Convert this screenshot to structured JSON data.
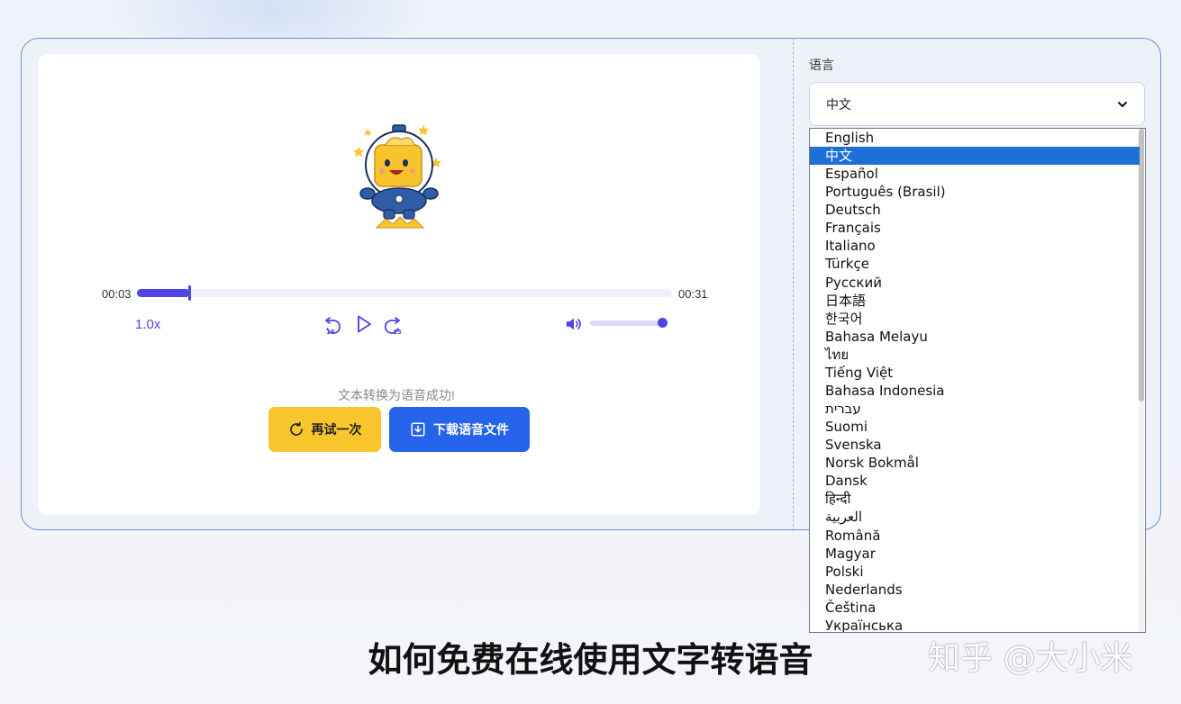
{
  "player": {
    "current_time": "00:03",
    "total_time": "00:31",
    "progress": 0.1,
    "speed": "1.0x",
    "volume": 0.95,
    "status_text": "文本转换为语音成功!",
    "retry_label": "再试一次",
    "download_label": "下载语音文件",
    "accent_color": "#4f46e5"
  },
  "language": {
    "label": "语言",
    "selected": "中文",
    "options": [
      "English",
      "中文",
      "Español",
      "Português (Brasil)",
      "Deutsch",
      "Français",
      "Italiano",
      "Türkçe",
      "Русский",
      "日本語",
      "한국어",
      "Bahasa Melayu",
      "ไทย",
      "Tiếng Việt",
      "Bahasa Indonesia",
      "עברית",
      "Suomi",
      "Svenska",
      "Norsk Bokmål",
      "Dansk",
      "हिन्दी",
      "العربية",
      "Română",
      "Magyar",
      "Polski",
      "Nederlands",
      "Čeština",
      "Українська"
    ]
  },
  "caption": "如何免费在线使用文字转语音",
  "watermark": "知乎 @大小米",
  "colors": {
    "retry_button": "#f8c62c",
    "download_button": "#2563eb",
    "selected_option": "#1f6fd9"
  },
  "icons": {
    "rewind": "rewind-15-icon",
    "play": "play-icon",
    "forward": "forward-15-icon",
    "volume": "volume-icon",
    "refresh": "refresh-icon",
    "download": "download-icon",
    "dropdown_arrow": "chevron-down-icon"
  }
}
